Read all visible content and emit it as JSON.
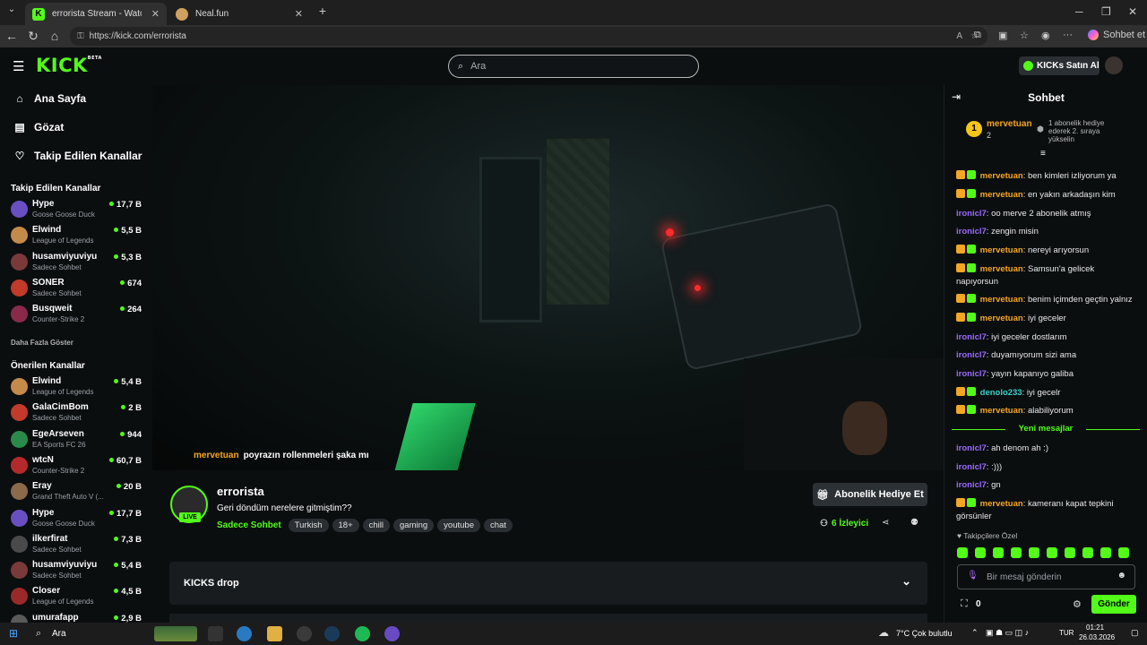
{
  "browser": {
    "tabs": [
      {
        "title": "errorista Stream - Watch Live",
        "favicon": "K"
      },
      {
        "title": "Neal.fun",
        "favicon": ""
      }
    ],
    "url": "https://kick.com/errorista",
    "copilot_label": "Sohbet et"
  },
  "header": {
    "logo": "KICK",
    "logo_beta": "BETA",
    "search_placeholder": "Ara",
    "kicks_button": "KICKs Satın Al"
  },
  "sidebar": {
    "nav": [
      {
        "label": "Ana Sayfa",
        "icon": "home-icon"
      },
      {
        "label": "Gözat",
        "icon": "browse-icon"
      },
      {
        "label": "Takip Edilen Kanallar",
        "icon": "heart-icon"
      }
    ],
    "followed_heading": "Takip Edilen Kanallar",
    "followed": [
      {
        "name": "Hype",
        "category": "Goose Goose Duck",
        "viewers": "17,7 B",
        "color": "#6a4fc2"
      },
      {
        "name": "Elwind",
        "category": "League of Legends",
        "viewers": "5,5 B",
        "color": "#c48a4a"
      },
      {
        "name": "husamviyuviyu",
        "category": "Sadece Sohbet",
        "viewers": "5,3 B",
        "color": "#7a3a3a"
      },
      {
        "name": "SONER",
        "category": "Sadece Sohbet",
        "viewers": "674",
        "color": "#c23a2a"
      },
      {
        "name": "Busqweit",
        "category": "Counter-Strike 2",
        "viewers": "264",
        "color": "#8a2a4a"
      }
    ],
    "show_more": "Daha Fazla Göster",
    "recommended_heading": "Önerilen Kanallar",
    "recommended": [
      {
        "name": "Elwind",
        "category": "League of Legends",
        "viewers": "5,4 B",
        "color": "#c48a4a"
      },
      {
        "name": "GalaCimBom",
        "category": "Sadece Sohbet",
        "viewers": "2 B",
        "color": "#c23a2a"
      },
      {
        "name": "EgeArseven",
        "category": "EA Sports FC 26",
        "viewers": "944",
        "color": "#2a8a4a"
      },
      {
        "name": "wtcN",
        "category": "Counter-Strike 2",
        "viewers": "60,7 B",
        "color": "#b42a2a"
      },
      {
        "name": "Eray",
        "category": "Grand Theft Auto V (...",
        "viewers": "20 B",
        "color": "#8a6a4a"
      },
      {
        "name": "Hype",
        "category": "Goose Goose Duck",
        "viewers": "17,7 B",
        "color": "#6a4fc2"
      },
      {
        "name": "ilkerfirat",
        "category": "Sadece Sohbet",
        "viewers": "7,3 B",
        "color": "#4a4a4a"
      },
      {
        "name": "husamviyuviyu",
        "category": "Sadece Sohbet",
        "viewers": "5,4 B",
        "color": "#7a3a3a"
      },
      {
        "name": "Closer",
        "category": "League of Legends",
        "viewers": "4,5 B",
        "color": "#9a2a2a"
      },
      {
        "name": "umurafapp",
        "category": "",
        "viewers": "2,9 B",
        "color": "#5a5a5a"
      }
    ]
  },
  "video": {
    "overlay_user": "mervetuan",
    "overlay_text": "poyrazın rollenmeleri şaka mı"
  },
  "channel": {
    "name": "errorista",
    "live_badge": "LIVE",
    "title": "Geri döndüm nerelere gitmiştim??",
    "category": "Sadece Sohbet",
    "tags": [
      "Turkish",
      "18+",
      "chill",
      "gaming",
      "youtube",
      "chat"
    ],
    "gift_button": "Abonelik Hediye Et",
    "viewers_count": "6",
    "viewers_label": "İzleyici",
    "kicks_drop": "KICKS drop"
  },
  "chat": {
    "title": "Sohbet",
    "pinned_user": "mervetuan",
    "pinned_rank": "1",
    "pinned_count": "2",
    "pinned_note": "1 abonelik hediye ederek 2. sıraya yükselin",
    "messages_before": [
      {
        "user": "mervetuan",
        "text": "ben kimleri izliyorum ya",
        "color": "#f5a623",
        "badges": true
      },
      {
        "user": "mervetuan",
        "text": "en yakın arkadaşın kim",
        "color": "#f5a623",
        "badges": true
      },
      {
        "user": "ironicl7",
        "text": "oo merve 2 abonelik atmış",
        "color": "#9b6bff",
        "badges": false
      },
      {
        "user": "ironicl7",
        "text": "zengin misin",
        "color": "#9b6bff",
        "badges": false
      },
      {
        "user": "mervetuan",
        "text": "nereyi arıyorsun",
        "color": "#f5a623",
        "badges": true
      },
      {
        "user": "mervetuan",
        "text": "Samsun'a gelicek napıyorsun",
        "color": "#f5a623",
        "badges": true
      },
      {
        "user": "mervetuan",
        "text": "benim içimden geçtin yalnız",
        "color": "#f5a623",
        "badges": true
      },
      {
        "user": "mervetuan",
        "text": "iyi geceler",
        "color": "#f5a623",
        "badges": true
      },
      {
        "user": "ironicl7",
        "text": "iyi geceler dostlarım",
        "color": "#9b6bff",
        "badges": false
      },
      {
        "user": "ironicl7",
        "text": "duyamıyorum sizi ama",
        "color": "#9b6bff",
        "badges": false
      },
      {
        "user": "ironicl7",
        "text": "yayın kapanıyo galiba",
        "color": "#9b6bff",
        "badges": false
      },
      {
        "user": "denolo233",
        "text": "iyi gecelr",
        "color": "#3ad0c8",
        "badges": true
      },
      {
        "user": "mervetuan",
        "text": "alabiliyorum",
        "color": "#f5a623",
        "badges": true
      }
    ],
    "new_messages_divider": "Yeni mesajlar",
    "messages_after": [
      {
        "user": "ironicl7",
        "text": "ah denom ah :)",
        "color": "#9b6bff",
        "badges": false
      },
      {
        "user": "ironicl7",
        "text": ":)))",
        "color": "#9b6bff",
        "badges": false
      },
      {
        "user": "ironicl7",
        "text": "gn",
        "color": "#9b6bff",
        "badges": false
      },
      {
        "user": "mervetuan",
        "text": "kameranı kapat tepkini görsünler",
        "color": "#f5a623",
        "badges": true
      }
    ],
    "emote_label": "Takipçilere Özel",
    "input_placeholder": "Bir mesaj gönderin",
    "kicks_balance": "0",
    "send_button": "Gönder"
  },
  "taskbar": {
    "search": "Ara",
    "weather": "7°C  Çok bulutlu",
    "lang": "TUR",
    "time": "01:21",
    "date": "26.03.2026"
  }
}
